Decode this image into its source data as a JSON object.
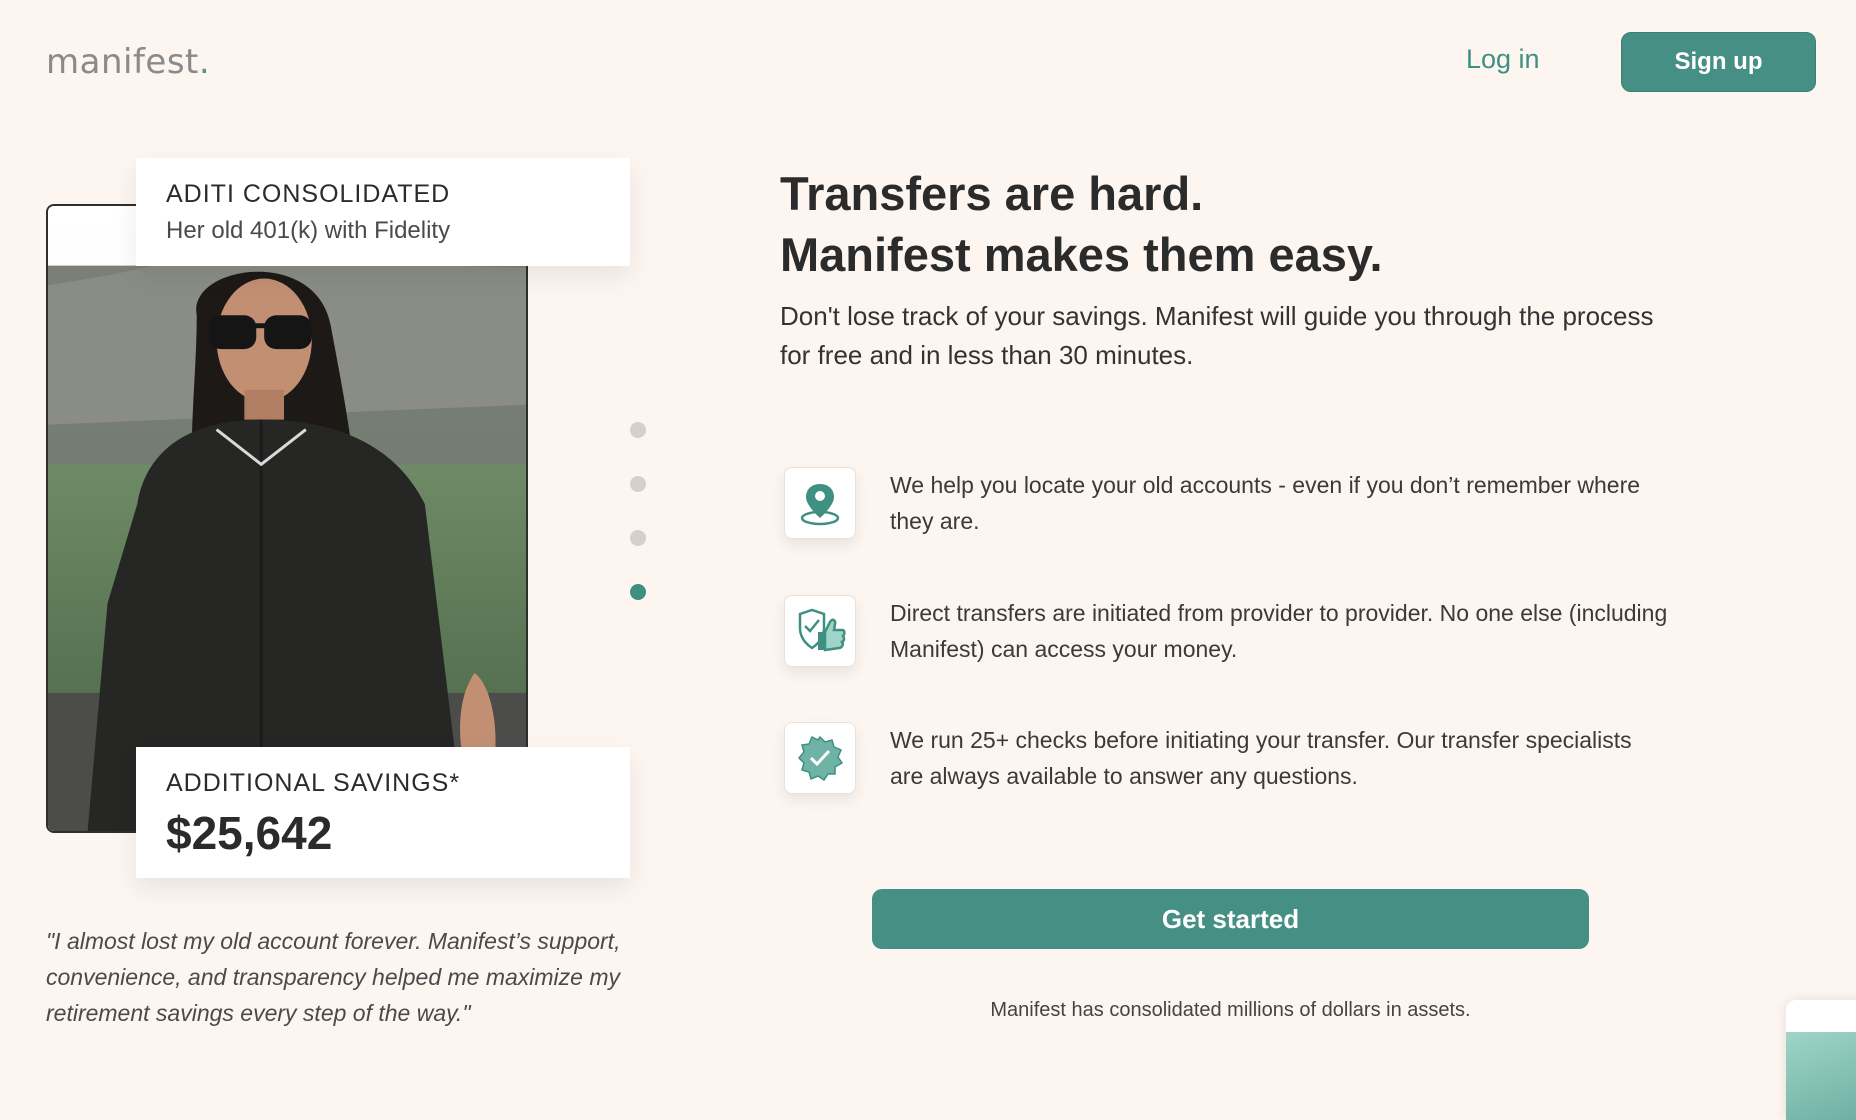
{
  "header": {
    "logo_text": "manifest",
    "logo_dot": ".",
    "login_label": "Log in",
    "signup_label": "Sign up"
  },
  "testimonial": {
    "name_card_title": "ADITI CONSOLIDATED",
    "name_card_subtitle": "Her old 401(k) with Fidelity",
    "savings_label": "ADDITIONAL SAVINGS*",
    "savings_value": "$25,642",
    "quote": "\"I almost lost my old account forever. Manifest’s support, convenience, and transparency helped me maximize my retirement savings every step of the way.\"",
    "carousel_active_index": 3,
    "carousel_count": 4
  },
  "hero": {
    "headline_line1": "Transfers are hard.",
    "headline_line2": "Manifest makes them easy.",
    "subtitle": "Don't lose track of your savings. Manifest will guide you through the process for free and in less than 30 minutes."
  },
  "features": [
    {
      "icon": "location-pin-icon",
      "text": "We help you locate your old accounts - even if you don’t remember where they are."
    },
    {
      "icon": "shield-thumbs-up-icon",
      "text": "Direct transfers are initiated from provider to provider. No one else (including Manifest) can access your money."
    },
    {
      "icon": "verified-badge-icon",
      "text": "We run 25+ checks before initiating your transfer. Our transfer specialists are always available to answer any questions."
    }
  ],
  "cta": {
    "label": "Get started",
    "footnote": "Manifest has consolidated millions of dollars in assets."
  },
  "colors": {
    "background": "#fdf5f0",
    "accent": "#468f85",
    "text": "#2b2b2b"
  }
}
